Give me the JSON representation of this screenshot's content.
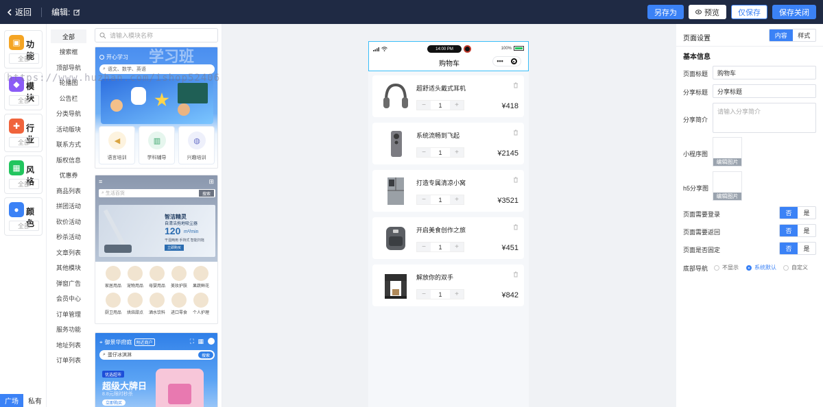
{
  "topbar": {
    "back": "返回",
    "edit": "编辑:",
    "save_as": "另存为",
    "preview": "预览",
    "save_only": "仅保存",
    "save_close": "保存关闭"
  },
  "rail": {
    "categories": [
      {
        "name": "功能",
        "all": "全部",
        "color": "#f5a524"
      },
      {
        "name": "模块",
        "all": "全部",
        "color": "#8b5cf6"
      },
      {
        "name": "行业",
        "all": "全部",
        "color": "#f0643c"
      },
      {
        "name": "风格",
        "all": "全部",
        "color": "#22c55e"
      },
      {
        "name": "颜色",
        "all": "全部",
        "color": "#3b82f6"
      }
    ],
    "tabs": [
      "广场",
      "私有"
    ]
  },
  "submenu": [
    "全部",
    "搜索框",
    "顶部导航",
    "轮播图",
    "公告栏",
    "分类导航",
    "活动版块",
    "联系方式",
    "版权信息",
    "优惠券",
    "商品列表",
    "拼团活动",
    "砍价活动",
    "秒杀活动",
    "文章列表",
    "其他模块",
    "弹窗广告",
    "会员中心",
    "订单管理",
    "服务功能",
    "地址列表",
    "订单列表"
  ],
  "modules": {
    "search_placeholder": "请输入模块名称",
    "card1": {
      "brand": "开心学习",
      "big": "学习班",
      "search": "语文、数学、英语",
      "tiles": [
        "语言培训",
        "学科辅导",
        "兴趣培训"
      ]
    },
    "card2": {
      "search": "生活百货",
      "search_btn": "搜索",
      "title": "智洁精灵",
      "sub": "自清洁拖地吸尘器",
      "speed": "120",
      "unit": "m²/min",
      "line": "干湿两用 手持式 智能扫拖",
      "btn": "立即购买",
      "cats": [
        "家居用品",
        "宠物用品",
        "母婴用品",
        "美妆护肤",
        "果蔬鲜花",
        "厨卫用品",
        "烘焙甜点",
        "酒水饮料",
        "进口零食",
        "个人护理"
      ]
    },
    "card3": {
      "location": "御景华府庭",
      "tag": "附近商户",
      "search": "蛋仔冰淇淋",
      "search_btn": "搜索",
      "badge": "优选超市",
      "headline": "超级大牌日",
      "sub": "8.8元限时秒杀",
      "btn": "立即购买"
    }
  },
  "phone": {
    "time": "14:00 PM",
    "battery": "100%",
    "title": "购物车",
    "items": [
      {
        "name": "超舒适头戴式耳机",
        "qty": "1",
        "price": "¥418"
      },
      {
        "name": "系统流畅到飞起",
        "qty": "1",
        "price": "¥2145"
      },
      {
        "name": "打造专属清凉小窝",
        "qty": "1",
        "price": "¥3521"
      },
      {
        "name": "开启美食创作之旅",
        "qty": "1",
        "price": "¥451"
      },
      {
        "name": "解放你的双手",
        "qty": "1",
        "price": "¥842"
      }
    ]
  },
  "panel": {
    "title": "页面设置",
    "tab_content": "内容",
    "tab_style": "样式",
    "section": "基本信息",
    "page_title_label": "页面标题",
    "page_title_value": "购物车",
    "share_title_label": "分享标题",
    "share_title_value": "分享标题",
    "share_desc_label": "分享简介",
    "share_desc_placeholder": "请输入分享简介",
    "mini_img_label": "小程序图",
    "h5_img_label": "h5分享图",
    "edit_img": "编辑图片",
    "login_label": "页面需要登录",
    "back_label": "页面需要返回",
    "fixed_label": "页面是否固定",
    "no": "否",
    "yes": "是",
    "nav_label": "底部导航",
    "nav_opts": [
      "不显示",
      "系统默认",
      "自定义"
    ]
  },
  "watermark": "https://www.huzhan.com/ishop52406",
  "colors": {
    "accent": "#3b82f6",
    "topbar": "#1f2a44"
  }
}
